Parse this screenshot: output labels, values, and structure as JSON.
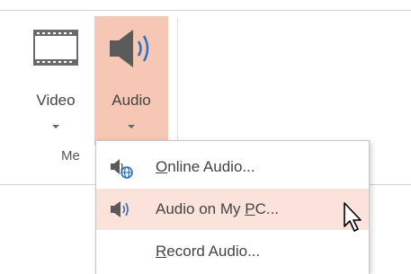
{
  "ribbon": {
    "video": {
      "label": "Video",
      "icon": "video-film-icon"
    },
    "audio": {
      "label": "Audio",
      "icon": "speaker-icon",
      "highlight": "#f5c7b4"
    },
    "group_label": "Me"
  },
  "menu": {
    "items": [
      {
        "prefix": "",
        "accel": "O",
        "suffix": "nline Audio...",
        "icon": "online-audio-icon"
      },
      {
        "prefix": "Audio on My ",
        "accel": "P",
        "suffix": "C...",
        "icon": "speaker-small-icon",
        "highlighted": true,
        "highlight": "#fbe3dc"
      },
      {
        "prefix": "",
        "accel": "R",
        "suffix": "ecord Audio...",
        "icon": ""
      }
    ]
  },
  "colors": {
    "accent_blue": "#2b6fc2",
    "icon_gray": "#5a5a5a"
  }
}
